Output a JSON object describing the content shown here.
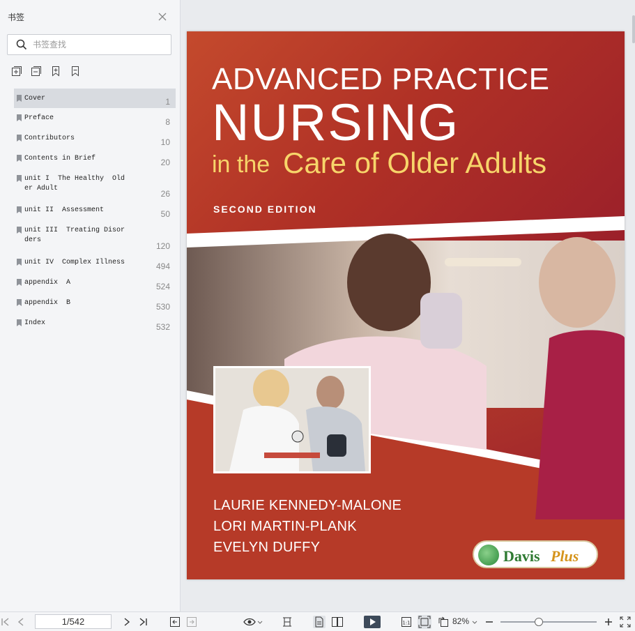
{
  "sidebar": {
    "title": "书签",
    "search_placeholder": "书签查找",
    "bookmarks": [
      {
        "label": "Cover",
        "page": "1"
      },
      {
        "label": "Preface",
        "page": "8"
      },
      {
        "label": "Contributors",
        "page": "10"
      },
      {
        "label": "Contents in Brief",
        "page": "20"
      },
      {
        "label": "unit I  The Healthy  Old\ner Adult",
        "page": "26"
      },
      {
        "label": "unit II  Assessment",
        "page": "50"
      },
      {
        "label": "unit III  Treating Disor\nders",
        "page": "120"
      },
      {
        "label": "unit IV  Complex Illness",
        "page": "494"
      },
      {
        "label": "appendix  A",
        "page": "524"
      },
      {
        "label": "appendix  B",
        "page": "530"
      },
      {
        "label": "Index",
        "page": "532"
      }
    ]
  },
  "cover": {
    "line1": "ADVANCED PRACTICE",
    "line2": "NURSING",
    "line3a": "in the",
    "line3b": "Care of Older Adults",
    "edition": "SECOND EDITION",
    "authors": [
      "LAURIE KENNEDY-MALONE",
      "LORI MARTIN-PLANK",
      "EVELYN DUFFY"
    ],
    "logo_a": "Davis",
    "logo_b": "Plus"
  },
  "toolbar": {
    "page_value": "1/542",
    "zoom": "82%"
  },
  "colors": {
    "accent": "#b03126",
    "title_gold": "#f7d56a"
  }
}
